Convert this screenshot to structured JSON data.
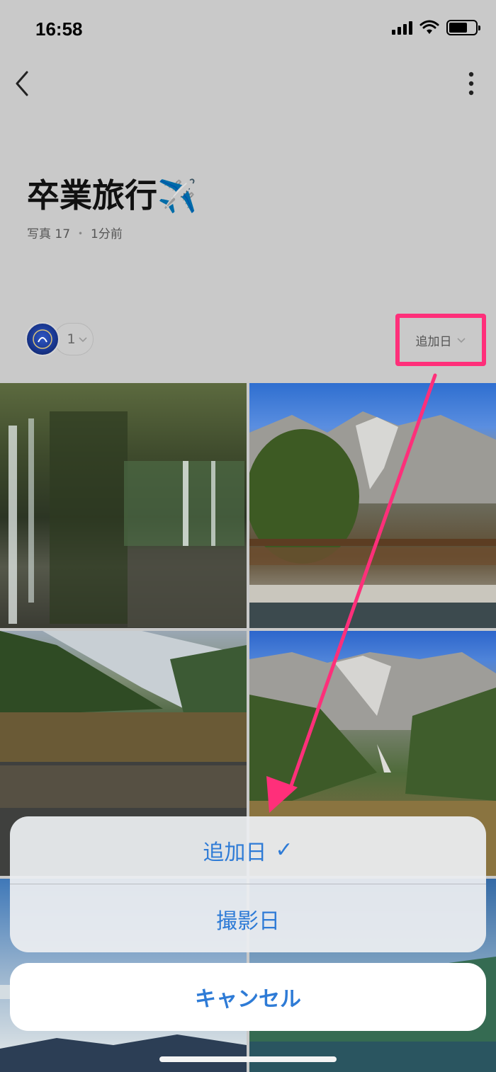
{
  "status_bar": {
    "time": "16:58"
  },
  "album": {
    "title": "卒業旅行✈️",
    "photo_label": "写真 17",
    "separator": "・",
    "updated": "1分前"
  },
  "members": {
    "count": "1"
  },
  "sort": {
    "label": "追加日"
  },
  "action_sheet": {
    "options": [
      {
        "label": "追加日",
        "check": "✓"
      },
      {
        "label": "撮影日"
      }
    ],
    "cancel": "キャンセル"
  },
  "colors": {
    "highlight": "#ff2f7a",
    "action_blue": "#2e7bd6"
  }
}
